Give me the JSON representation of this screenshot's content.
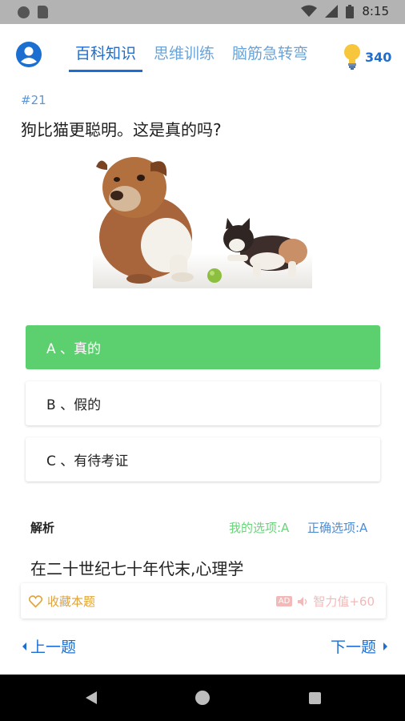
{
  "status_bar": {
    "time": "8:15"
  },
  "header": {
    "tabs": [
      {
        "label": "百科知识",
        "active": true
      },
      {
        "label": "思维训练",
        "active": false
      },
      {
        "label": "脑筋急转弯",
        "active": false
      }
    ],
    "score": "340"
  },
  "question": {
    "number": "#21",
    "text": "狗比猫更聪明。这是真的吗?"
  },
  "options": [
    {
      "label": "A 、真的",
      "state": "correct"
    },
    {
      "label": "B 、假的",
      "state": "normal"
    },
    {
      "label": "C 、有待考证",
      "state": "normal"
    }
  ],
  "explanation": {
    "title": "解析",
    "my_choice": "我的选项:A",
    "correct_choice": "正确选项:A",
    "text": "在二十世纪七十年代末,心理学"
  },
  "bottom_bar": {
    "favorite_label": "收藏本题",
    "ad_badge": "AD",
    "reward_label": "智力值+60"
  },
  "nav": {
    "prev_label": "上一题",
    "next_label": "下一题"
  },
  "colors": {
    "accent": "#1c6fd1",
    "correct_green": "#5ccf6e",
    "favorite_orange": "#e0a33a"
  }
}
